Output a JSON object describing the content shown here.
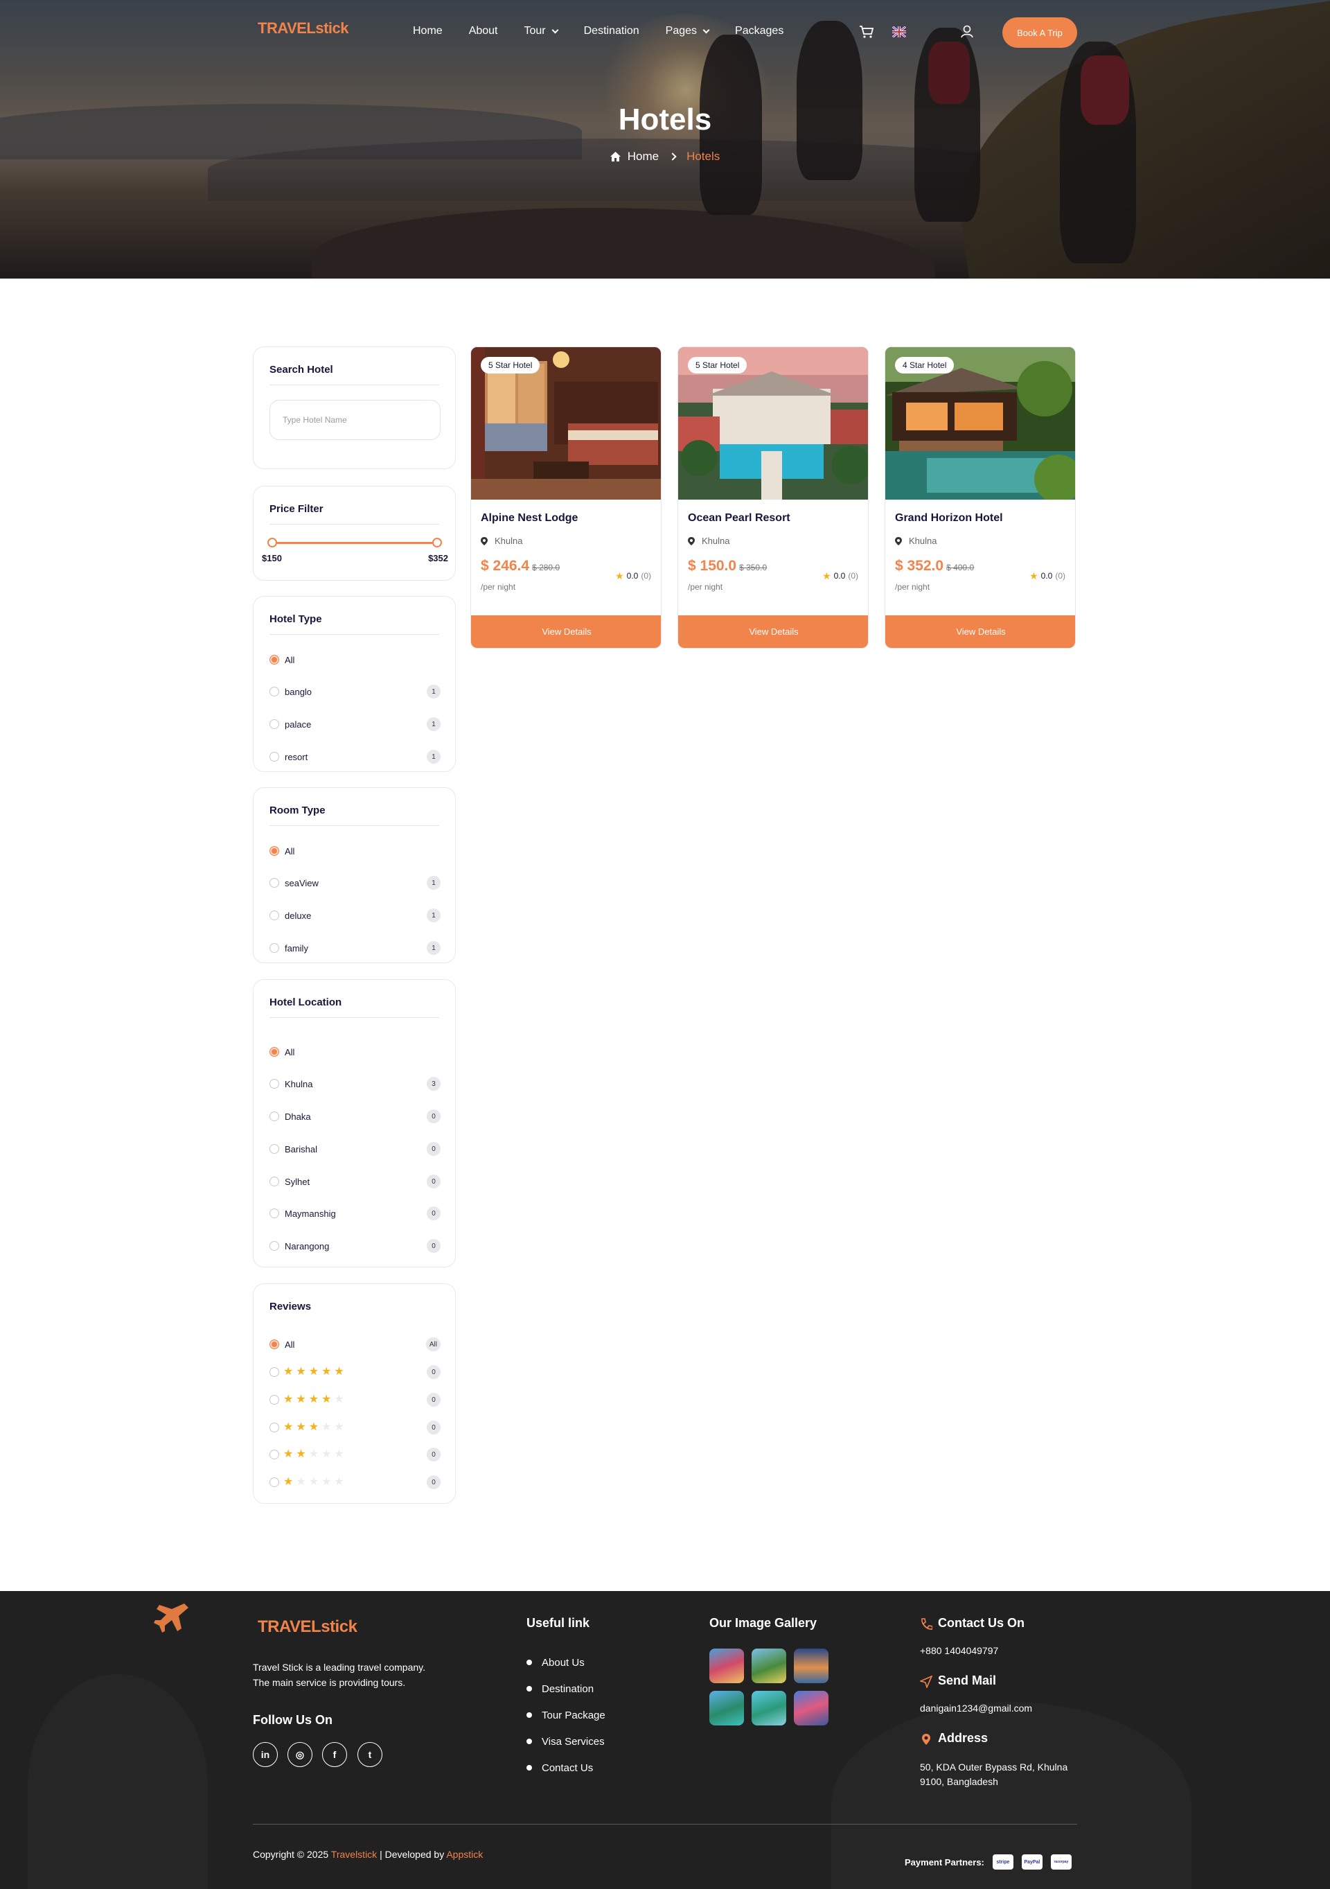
{
  "brand": {
    "logo_part1": "TRAVEL",
    "logo_part2": "stick"
  },
  "nav": {
    "items": [
      {
        "label": "Home",
        "dropdown": false
      },
      {
        "label": "About",
        "dropdown": false
      },
      {
        "label": "Tour",
        "dropdown": true
      },
      {
        "label": "Destination",
        "dropdown": false
      },
      {
        "label": "Pages",
        "dropdown": true
      },
      {
        "label": "Packages",
        "dropdown": false
      }
    ],
    "cta": "Book A Trip",
    "icons": [
      "cart-icon",
      "uk-flag-icon",
      "user-icon"
    ]
  },
  "hero": {
    "title": "Hotels",
    "breadcrumb": {
      "home": "Home",
      "current": "Hotels"
    }
  },
  "sidebar": {
    "search": {
      "title": "Search Hotel",
      "placeholder": "Type Hotel Name",
      "value": ""
    },
    "price": {
      "title": "Price Filter",
      "min": "$150",
      "max": "$352"
    },
    "hotel_type": {
      "title": "Hotel Type",
      "options": [
        {
          "label": "All",
          "count": "",
          "selected": true
        },
        {
          "label": "banglo",
          "count": "1",
          "selected": false
        },
        {
          "label": "palace",
          "count": "1",
          "selected": false
        },
        {
          "label": "resort",
          "count": "1",
          "selected": false
        }
      ]
    },
    "room_type": {
      "title": "Room Type",
      "options": [
        {
          "label": "All",
          "count": "",
          "selected": true
        },
        {
          "label": "seaView",
          "count": "1",
          "selected": false
        },
        {
          "label": "deluxe",
          "count": "1",
          "selected": false
        },
        {
          "label": "family",
          "count": "1",
          "selected": false
        }
      ]
    },
    "location": {
      "title": "Hotel Location",
      "options": [
        {
          "label": "All",
          "count": "",
          "selected": true
        },
        {
          "label": "Khulna",
          "count": "3",
          "selected": false
        },
        {
          "label": "Dhaka",
          "count": "0",
          "selected": false
        },
        {
          "label": "Barishal",
          "count": "0",
          "selected": false
        },
        {
          "label": "Sylhet",
          "count": "0",
          "selected": false
        },
        {
          "label": "Maymanshig",
          "count": "0",
          "selected": false
        },
        {
          "label": "Narangong",
          "count": "0",
          "selected": false
        }
      ]
    },
    "reviews": {
      "title": "Reviews",
      "all": {
        "label": "All",
        "count": "All"
      },
      "rows": [
        {
          "stars": 5,
          "count": "0"
        },
        {
          "stars": 4,
          "count": "0"
        },
        {
          "stars": 3,
          "count": "0"
        },
        {
          "stars": 2,
          "count": "0"
        },
        {
          "stars": 1,
          "count": "0"
        }
      ]
    }
  },
  "hotels": [
    {
      "tag": "5 Star Hotel",
      "name": "Alpine Nest Lodge",
      "location": "Khulna",
      "price": "$ 246.4",
      "old_price": "$ 280.0",
      "per": "/per night",
      "rating": "0.0",
      "reviews": "(0)",
      "button": "View Details"
    },
    {
      "tag": "5 Star Hotel",
      "name": "Ocean Pearl Resort",
      "location": "Khulna",
      "price": "$ 150.0",
      "old_price": "$ 350.0",
      "per": "/per night",
      "rating": "0.0",
      "reviews": "(0)",
      "button": "View Details"
    },
    {
      "tag": "4 Star Hotel",
      "name": "Grand Horizon Hotel",
      "location": "Khulna",
      "price": "$ 352.0",
      "old_price": "$ 400.0",
      "per": "/per night",
      "rating": "0.0",
      "reviews": "(0)",
      "button": "View Details"
    }
  ],
  "footer": {
    "about_line1": "Travel Stick is a leading travel company.",
    "about_line2": "The main service is providing tours.",
    "follow_title": "Follow Us On",
    "social": [
      {
        "icon": "linkedin-icon",
        "glyph": "in"
      },
      {
        "icon": "instagram-icon",
        "glyph": "◎"
      },
      {
        "icon": "facebook-icon",
        "glyph": "f"
      },
      {
        "icon": "twitter-icon",
        "glyph": "t"
      }
    ],
    "useful_title": "Useful link",
    "links": [
      "About Us",
      "Destination",
      "Tour Package",
      "Visa Services",
      "Contact Us"
    ],
    "gallery_title": "Our Image Gallery",
    "contact_title": "Contact Us On",
    "phone": "+880 1404049797",
    "mail_title": "Send Mail",
    "email": "danigain1234@gmail.com",
    "address_title": "Address",
    "address_line1": "50, KDA Outer Bypass Rd, Khulna",
    "address_line2": "9100, Bangladesh",
    "copyright_pre": "Copyright © 2025 ",
    "copyright_brand": "Travelstick",
    "copyright_mid": " | Developed by ",
    "copyright_dev": "Appstick",
    "partners_label": "Payment Partners:",
    "partners": [
      "stripe",
      "PayPal",
      "razorpay"
    ]
  },
  "colors": {
    "accent": "#f0844a",
    "dark": "#16163a",
    "footer_bg": "#212121",
    "star": "#f5b21b"
  }
}
